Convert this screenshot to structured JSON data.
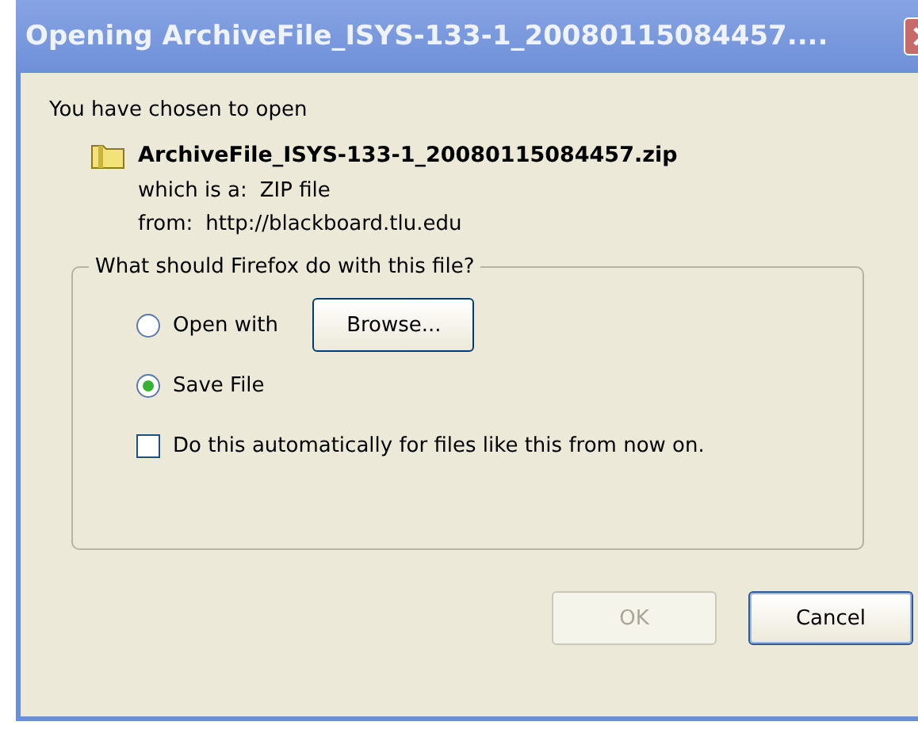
{
  "window": {
    "title": "Opening ArchiveFile_ISYS-133-1_20080115084457...."
  },
  "intro": "You have chosen to open",
  "file": {
    "name": "ArchiveFile_ISYS-133-1_20080115084457.zip",
    "type_label": "which is a:",
    "type": "ZIP file",
    "from_label": "from:",
    "from": "http://blackboard.tlu.edu"
  },
  "group": {
    "legend": "What should Firefox do with this file?",
    "options": [
      {
        "label": "Open with",
        "selected": false,
        "button": "Browse..."
      },
      {
        "label": "Save File",
        "selected": true
      }
    ],
    "auto": {
      "label": "Do this automatically for files like this from now on.",
      "checked": false
    }
  },
  "buttons": [
    {
      "label": "OK",
      "disabled": true
    },
    {
      "label": "Cancel",
      "disabled": false
    }
  ]
}
